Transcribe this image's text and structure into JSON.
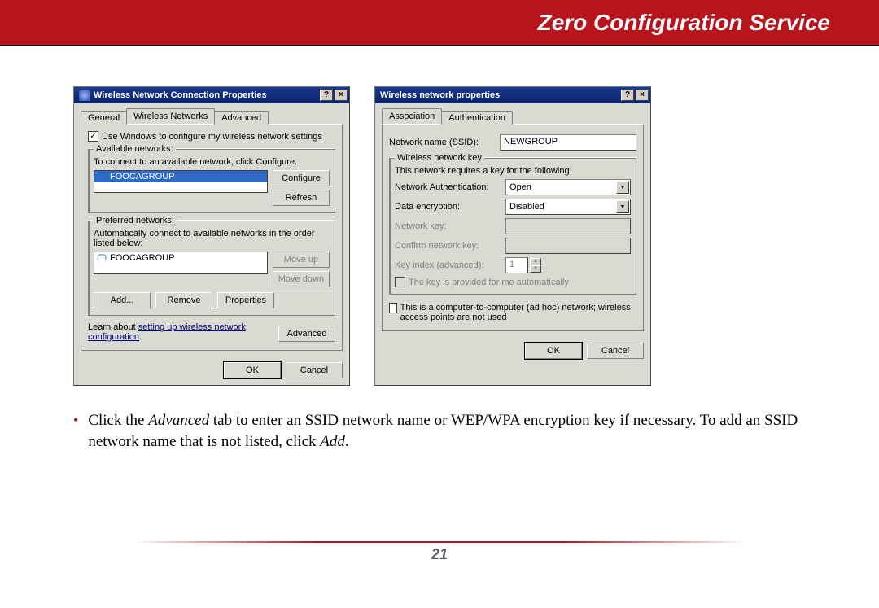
{
  "header": {
    "title": "Zero Configuration Service"
  },
  "dialog1": {
    "title": "Wireless Network Connection Properties",
    "help_label": "?",
    "close_label": "×",
    "tabs": [
      "General",
      "Wireless Networks",
      "Advanced"
    ],
    "active_tab": "Wireless Networks",
    "use_windows_checkbox": "Use Windows to configure my wireless network settings",
    "available_legend": "Available networks:",
    "available_hint": "To connect to an available network, click Configure.",
    "available_items": [
      "FOOCAGROUP"
    ],
    "configure_btn": "Configure",
    "refresh_btn": "Refresh",
    "preferred_legend": "Preferred networks:",
    "preferred_hint": "Automatically connect to available networks in the order listed below:",
    "preferred_items": [
      "FOOCAGROUP"
    ],
    "move_up_btn": "Move up",
    "move_down_btn": "Move down",
    "add_btn": "Add...",
    "remove_btn": "Remove",
    "properties_btn": "Properties",
    "learn_text_a": "Learn about ",
    "learn_link": "setting up wireless network configuration",
    "learn_text_b": ".",
    "advanced_btn": "Advanced",
    "ok_btn": "OK",
    "cancel_btn": "Cancel"
  },
  "dialog2": {
    "title": "Wireless network properties",
    "help_label": "?",
    "close_label": "×",
    "tabs": [
      "Association",
      "Authentication"
    ],
    "active_tab": "Association",
    "ssid_label": "Network name (SSID):",
    "ssid_value": "NEWGROUP",
    "wkey_legend": "Wireless network key",
    "wkey_hint": "This network requires a key for the following:",
    "net_auth_label": "Network Authentication:",
    "net_auth_value": "Open",
    "data_enc_label": "Data encryption:",
    "data_enc_value": "Disabled",
    "netkey_label": "Network key:",
    "confirm_label": "Confirm network key:",
    "keyindex_label": "Key index (advanced):",
    "keyindex_value": "1",
    "autokey_label": "The key is provided for me automatically",
    "adhoc_label": "This is a computer-to-computer (ad hoc) network; wireless access points are not used",
    "ok_btn": "OK",
    "cancel_btn": "Cancel"
  },
  "instruction": {
    "text_a": "Click the ",
    "em1": "Advanced",
    "text_b": " tab to enter an SSID network name or WEP/WPA encryption key if necessary.  To add an SSID network name that is not listed, click ",
    "em2": "Add",
    "text_c": "."
  },
  "page_number": "21"
}
